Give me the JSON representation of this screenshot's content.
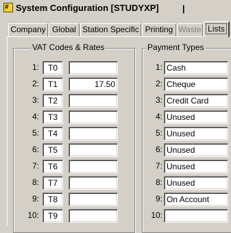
{
  "window": {
    "title": "System Configuration [STUDYXP]",
    "title_cursor": "|",
    "icon_glyph": "#"
  },
  "tabs": [
    {
      "label": "Company",
      "state": "normal"
    },
    {
      "label": "Global",
      "state": "normal"
    },
    {
      "label": "Station Specific",
      "state": "normal"
    },
    {
      "label": "Printing",
      "state": "normal"
    },
    {
      "label": "Waste",
      "state": "disabled"
    },
    {
      "label": "Lists",
      "state": "active"
    }
  ],
  "vat": {
    "title": "VAT Codes & Rates",
    "rows": [
      {
        "num": "1:",
        "code": "T0",
        "rate": ""
      },
      {
        "num": "2:",
        "code": "T1",
        "rate": "17.50"
      },
      {
        "num": "3:",
        "code": "T2",
        "rate": ""
      },
      {
        "num": "4:",
        "code": "T3",
        "rate": ""
      },
      {
        "num": "5:",
        "code": "T4",
        "rate": ""
      },
      {
        "num": "6:",
        "code": "T5",
        "rate": ""
      },
      {
        "num": "7:",
        "code": "T6",
        "rate": ""
      },
      {
        "num": "8:",
        "code": "T7",
        "rate": ""
      },
      {
        "num": "9:",
        "code": "T8",
        "rate": ""
      },
      {
        "num": "10:",
        "code": "T9",
        "rate": ""
      }
    ]
  },
  "payment": {
    "title": "Payment Types",
    "rows": [
      {
        "num": "1:",
        "value": "Cash"
      },
      {
        "num": "2:",
        "value": "Cheque"
      },
      {
        "num": "3:",
        "value": "Credit Card"
      },
      {
        "num": "4:",
        "value": "Unused"
      },
      {
        "num": "5:",
        "value": "Unused"
      },
      {
        "num": "6:",
        "value": "Unused"
      },
      {
        "num": "7:",
        "value": "Unused"
      },
      {
        "num": "8:",
        "value": "Unused"
      },
      {
        "num": "9:",
        "value": "On Account"
      },
      {
        "num": "10:",
        "value": ""
      }
    ]
  }
}
